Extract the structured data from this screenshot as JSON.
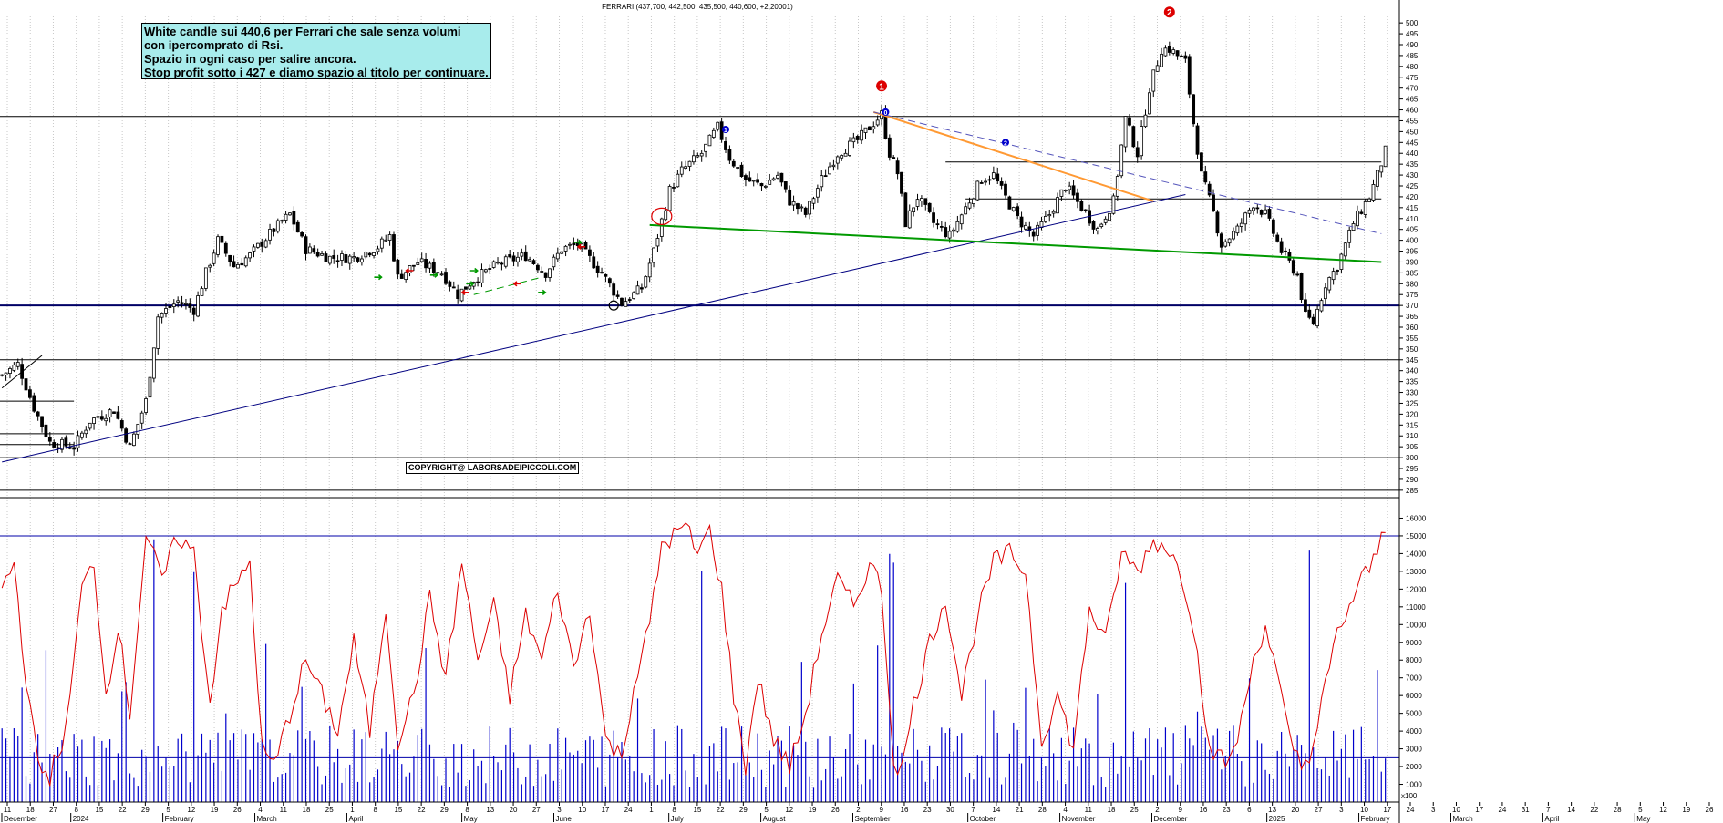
{
  "chart_data": {
    "type": "candlestick",
    "title": "FERRARI (437,700, 442,500, 435,500, 440,600, +2,20001)",
    "annotation": {
      "lines": [
        "White candle sui 440,6 per Ferrari che sale senza volumi",
        "con ipercomprato di Rsi.",
        "Spazio in ogni caso per salire ancora.",
        "Stop profit sotto i 427 e diamo spazio al titolo per continuare."
      ]
    },
    "copyright": "COPYRIGHT@ LABORSADEIPICCOLI.COM",
    "markers": [
      {
        "label": "1",
        "x_index": 220,
        "y": 471,
        "color": "#dd0000"
      },
      {
        "label": "2",
        "x_index": 292,
        "y": 505,
        "color": "#dd0000"
      },
      {
        "label": "0",
        "x_index": 221,
        "y": 459,
        "color": "#0000cc"
      },
      {
        "label": "1",
        "x_index": 181,
        "y": 451,
        "color": "#0000cc"
      },
      {
        "label": "2",
        "x_index": 251,
        "y": 445,
        "color": "#0000cc"
      }
    ],
    "price_axis": {
      "ylim": [
        282,
        503
      ],
      "tick_step": 5,
      "tick_labels": [
        "285",
        "290",
        "295",
        "300",
        "305",
        "310",
        "315",
        "320",
        "325",
        "330",
        "335",
        "340",
        "345",
        "350",
        "355",
        "360",
        "365",
        "370",
        "375",
        "380",
        "385",
        "390",
        "395",
        "400",
        "405",
        "410",
        "415",
        "420",
        "425",
        "430",
        "435",
        "440",
        "445",
        "450",
        "455",
        "460",
        "465",
        "470",
        "475",
        "480",
        "485",
        "490",
        "495",
        "500"
      ]
    },
    "volume_axis": {
      "ylim": [
        0,
        17000
      ],
      "tick_labels": [
        "1000",
        "2000",
        "3000",
        "4000",
        "5000",
        "6000",
        "7000",
        "8000",
        "9000",
        "10000",
        "11000",
        "12000",
        "13000",
        "14000",
        "15000",
        "16000"
      ],
      "unit_label": "x100"
    },
    "x_day_ticks": [
      "11",
      "18",
      "27",
      "8",
      "15",
      "22",
      "29",
      "5",
      "12",
      "19",
      "26",
      "4",
      "11",
      "18",
      "25",
      "1",
      "8",
      "15",
      "22",
      "29",
      "8",
      "13",
      "20",
      "27",
      "3",
      "10",
      "17",
      "24",
      "1",
      "8",
      "15",
      "22",
      "29",
      "5",
      "12",
      "19",
      "26",
      "2",
      "9",
      "16",
      "23",
      "30",
      "7",
      "14",
      "21",
      "28",
      "4",
      "11",
      "18",
      "25",
      "2",
      "9",
      "16",
      "23",
      "6",
      "13",
      "20",
      "27",
      "3",
      "10",
      "17",
      "24",
      "3",
      "10",
      "17",
      "24",
      "31",
      "7",
      "14",
      "22",
      "28",
      "5",
      "12",
      "19",
      "26"
    ],
    "x_month_labels": [
      "December",
      "2024",
      "February",
      "March",
      "April",
      "May",
      "June",
      "July",
      "August",
      "September",
      "October",
      "November",
      "December",
      "2025",
      "February",
      "March",
      "April",
      "May"
    ],
    "horizontal_levels": [
      {
        "y": 457,
        "color": "#000000",
        "full": true
      },
      {
        "y": 370,
        "color": "#000066",
        "full": true,
        "bold": true
      },
      {
        "y": 345,
        "color": "#000000",
        "full": true
      },
      {
        "y": 300,
        "color": "#000000",
        "full": true
      },
      {
        "y": 285,
        "color": "#000000",
        "full": true
      },
      {
        "y": 326,
        "color": "#000000",
        "x_end_index": 18
      },
      {
        "y": 311,
        "color": "#000000",
        "x_end_index": 18
      },
      {
        "y": 306,
        "color": "#000000",
        "x_end_index": 18
      },
      {
        "y": 436,
        "color": "#000000",
        "x_start_index": 236,
        "x_end_index": 345
      },
      {
        "y": 419,
        "color": "#000000",
        "x_start_index": 241,
        "x_end_index": 345
      }
    ],
    "trendlines": [
      {
        "name": "support",
        "color": "#000080",
        "from": {
          "x_index": 0,
          "y": 298
        },
        "to": {
          "x_index": 296,
          "y": 421
        }
      },
      {
        "name": "neckline",
        "color": "#009900",
        "from": {
          "x_index": 162,
          "y": 407
        },
        "to": {
          "x_index": 345,
          "y": 390
        },
        "bold": true
      },
      {
        "name": "resistance",
        "color": "#ff9933",
        "from": {
          "x_index": 218,
          "y": 459
        },
        "to": {
          "x_index": 288,
          "y": 418
        },
        "bold": true
      },
      {
        "name": "resistance-long",
        "color": "#5555bb",
        "from": {
          "x_index": 218,
          "y": 459
        },
        "to": {
          "x_index": 345,
          "y": 403
        },
        "dashed": true
      },
      {
        "name": "early-channel",
        "color": "#000000",
        "from": {
          "x_index": 0,
          "y": 332
        },
        "to": {
          "x_index": 10,
          "y": 347
        }
      },
      {
        "name": "wedge",
        "color": "#009900",
        "from": {
          "x_index": 118,
          "y": 375
        },
        "to": {
          "x_index": 135,
          "y": 383
        },
        "dashed": true
      }
    ],
    "circles": [
      {
        "x_index": 165,
        "y": 411,
        "color": "#dd0000",
        "rx": 11,
        "ry": 9
      },
      {
        "x_index": 153,
        "y": 370,
        "color": "#000000",
        "rx": 5,
        "ry": 5
      }
    ],
    "arrows": [
      {
        "x_index": 94,
        "y": 383,
        "dir": "right",
        "color": "#009900"
      },
      {
        "x_index": 102,
        "y": 386,
        "dir": "left",
        "color": "#dd0000"
      },
      {
        "x_index": 108,
        "y": 384,
        "dir": "right",
        "color": "#009900"
      },
      {
        "x_index": 117,
        "y": 380,
        "dir": "right",
        "color": "#009900"
      },
      {
        "x_index": 116,
        "y": 376,
        "dir": "left",
        "color": "#dd0000"
      },
      {
        "x_index": 118,
        "y": 386,
        "dir": "right",
        "color": "#009900"
      },
      {
        "x_index": 129,
        "y": 380,
        "dir": "left",
        "color": "#dd0000"
      },
      {
        "x_index": 135,
        "y": 376,
        "dir": "right",
        "color": "#009900"
      },
      {
        "x_index": 144,
        "y": 399,
        "dir": "right",
        "color": "#009900"
      },
      {
        "x_index": 145,
        "y": 397,
        "dir": "left",
        "color": "#dd0000"
      }
    ],
    "series": [
      {
        "name": "price",
        "anchors": [
          [
            0,
            338
          ],
          [
            4,
            343
          ],
          [
            8,
            323
          ],
          [
            12,
            307
          ],
          [
            18,
            305
          ],
          [
            22,
            317
          ],
          [
            28,
            322
          ],
          [
            32,
            305
          ],
          [
            36,
            326
          ],
          [
            39,
            365
          ],
          [
            44,
            372
          ],
          [
            48,
            368
          ],
          [
            51,
            385
          ],
          [
            54,
            400
          ],
          [
            58,
            388
          ],
          [
            62,
            393
          ],
          [
            68,
            405
          ],
          [
            72,
            412
          ],
          [
            76,
            396
          ],
          [
            82,
            392
          ],
          [
            88,
            392
          ],
          [
            94,
            397
          ],
          [
            97,
            402
          ],
          [
            99,
            383
          ],
          [
            104,
            390
          ],
          [
            110,
            385
          ],
          [
            114,
            375
          ],
          [
            118,
            382
          ],
          [
            124,
            389
          ],
          [
            131,
            393
          ],
          [
            136,
            385
          ],
          [
            140,
            396
          ],
          [
            144,
            398
          ],
          [
            150,
            385
          ],
          [
            155,
            371
          ],
          [
            160,
            378
          ],
          [
            163,
            395
          ],
          [
            167,
            423
          ],
          [
            170,
            432
          ],
          [
            175,
            440
          ],
          [
            179,
            452
          ],
          [
            182,
            438
          ],
          [
            186,
            428
          ],
          [
            190,
            425
          ],
          [
            194,
            430
          ],
          [
            197,
            418
          ],
          [
            201,
            412
          ],
          [
            205,
            428
          ],
          [
            209,
            440
          ],
          [
            214,
            446
          ],
          [
            217,
            452
          ],
          [
            220,
            458
          ],
          [
            222,
            440
          ],
          [
            224,
            431
          ],
          [
            226,
            408
          ],
          [
            229,
            420
          ],
          [
            233,
            408
          ],
          [
            237,
            402
          ],
          [
            241,
            415
          ],
          [
            245,
            428
          ],
          [
            248,
            430
          ],
          [
            250,
            423
          ],
          [
            254,
            410
          ],
          [
            258,
            402
          ],
          [
            262,
            412
          ],
          [
            266,
            425
          ],
          [
            270,
            415
          ],
          [
            274,
            405
          ],
          [
            278,
            418
          ],
          [
            281,
            456
          ],
          [
            284,
            440
          ],
          [
            287,
            470
          ],
          [
            290,
            488
          ],
          [
            292,
            488
          ],
          [
            296,
            482
          ],
          [
            298,
            454
          ],
          [
            300,
            430
          ],
          [
            303,
            413
          ],
          [
            305,
            398
          ],
          [
            309,
            405
          ],
          [
            313,
            417
          ],
          [
            316,
            412
          ],
          [
            320,
            395
          ],
          [
            324,
            384
          ],
          [
            326,
            365
          ],
          [
            328,
            362
          ],
          [
            331,
            380
          ],
          [
            334,
            388
          ],
          [
            338,
            408
          ],
          [
            342,
            420
          ],
          [
            344,
            430
          ],
          [
            346,
            441
          ]
        ]
      },
      {
        "name": "rsi",
        "color": "#dd0000",
        "anchors": [
          [
            0,
            12000
          ],
          [
            3,
            13500
          ],
          [
            6,
            7000
          ],
          [
            9,
            2000
          ],
          [
            12,
            1500
          ],
          [
            16,
            4000
          ],
          [
            20,
            12000
          ],
          [
            23,
            13500
          ],
          [
            26,
            6000
          ],
          [
            29,
            10000
          ],
          [
            32,
            5000
          ],
          [
            36,
            15000
          ],
          [
            40,
            12500
          ],
          [
            44,
            15000
          ],
          [
            48,
            14000
          ],
          [
            52,
            5500
          ],
          [
            55,
            11000
          ],
          [
            58,
            12000
          ],
          [
            62,
            13500
          ],
          [
            65,
            3000
          ],
          [
            68,
            2000
          ],
          [
            72,
            5000
          ],
          [
            76,
            8000
          ],
          [
            80,
            6000
          ],
          [
            84,
            4000
          ],
          [
            88,
            9000
          ],
          [
            92,
            4000
          ],
          [
            96,
            11000
          ],
          [
            99,
            3500
          ],
          [
            103,
            6000
          ],
          [
            107,
            11500
          ],
          [
            111,
            7000
          ],
          [
            115,
            13500
          ],
          [
            119,
            8000
          ],
          [
            123,
            11000
          ],
          [
            127,
            6000
          ],
          [
            131,
            10500
          ],
          [
            135,
            8000
          ],
          [
            139,
            12000
          ],
          [
            143,
            7500
          ],
          [
            147,
            11000
          ],
          [
            151,
            3500
          ],
          [
            155,
            2500
          ],
          [
            158,
            6500
          ],
          [
            162,
            10000
          ],
          [
            165,
            14500
          ],
          [
            168,
            15000
          ],
          [
            171,
            15500
          ],
          [
            174,
            14000
          ],
          [
            177,
            15300
          ],
          [
            180,
            12000
          ],
          [
            183,
            6000
          ],
          [
            186,
            2000
          ],
          [
            189,
            7000
          ],
          [
            193,
            3500
          ],
          [
            197,
            2000
          ],
          [
            201,
            5000
          ],
          [
            205,
            9500
          ],
          [
            209,
            12500
          ],
          [
            213,
            11000
          ],
          [
            217,
            13500
          ],
          [
            220,
            12000
          ],
          [
            223,
            2500
          ],
          [
            225,
            1800
          ],
          [
            228,
            5500
          ],
          [
            232,
            9000
          ],
          [
            236,
            11500
          ],
          [
            240,
            6000
          ],
          [
            244,
            10500
          ],
          [
            248,
            13500
          ],
          [
            252,
            14000
          ],
          [
            256,
            13000
          ],
          [
            260,
            3500
          ],
          [
            264,
            6000
          ],
          [
            268,
            3000
          ],
          [
            272,
            11000
          ],
          [
            276,
            9000
          ],
          [
            280,
            14000
          ],
          [
            284,
            13000
          ],
          [
            288,
            14700
          ],
          [
            292,
            14300
          ],
          [
            296,
            12000
          ],
          [
            299,
            9000
          ],
          [
            301,
            4000
          ],
          [
            304,
            2500
          ],
          [
            307,
            2200
          ],
          [
            310,
            4500
          ],
          [
            313,
            8000
          ],
          [
            316,
            10000
          ],
          [
            319,
            7000
          ],
          [
            322,
            3500
          ],
          [
            325,
            2000
          ],
          [
            328,
            3200
          ],
          [
            331,
            6500
          ],
          [
            334,
            9500
          ],
          [
            337,
            11000
          ],
          [
            340,
            12500
          ],
          [
            343,
            13500
          ],
          [
            346,
            15600
          ]
        ]
      }
    ]
  }
}
